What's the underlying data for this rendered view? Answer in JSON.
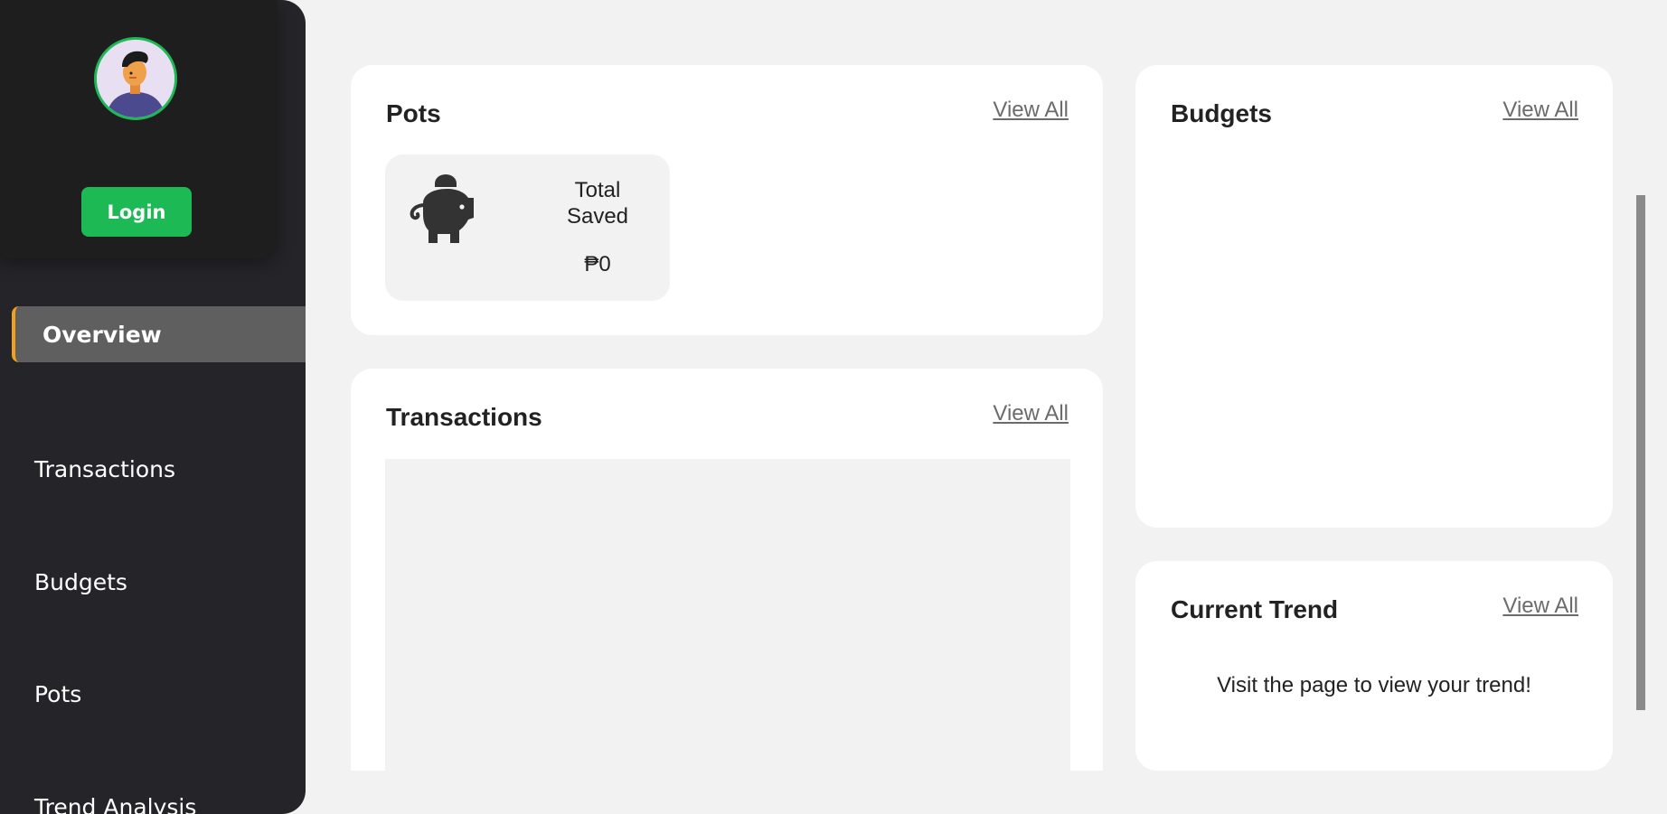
{
  "sidebar": {
    "login_label": "Login",
    "nav": [
      {
        "label": "Overview",
        "active": true
      },
      {
        "label": "Transactions",
        "active": false
      },
      {
        "label": "Budgets",
        "active": false
      },
      {
        "label": "Pots",
        "active": false
      },
      {
        "label": "Trend Analysis",
        "active": false
      }
    ]
  },
  "pots": {
    "title": "Pots",
    "view_all": "View All",
    "total_saved_label": "Total Saved",
    "total_saved_value": "₱0",
    "icon": "piggy-bank-icon"
  },
  "transactions": {
    "title": "Transactions",
    "view_all": "View All"
  },
  "budgets": {
    "title": "Budgets",
    "view_all": "View All"
  },
  "trend": {
    "title": "Current Trend",
    "view_all": "View All",
    "message": "Visit the page to view your trend!"
  },
  "colors": {
    "sidebar_bg": "#252428",
    "accent_green": "#1db954",
    "active_marker": "#f0a21c",
    "page_bg": "#f2f2f2"
  }
}
